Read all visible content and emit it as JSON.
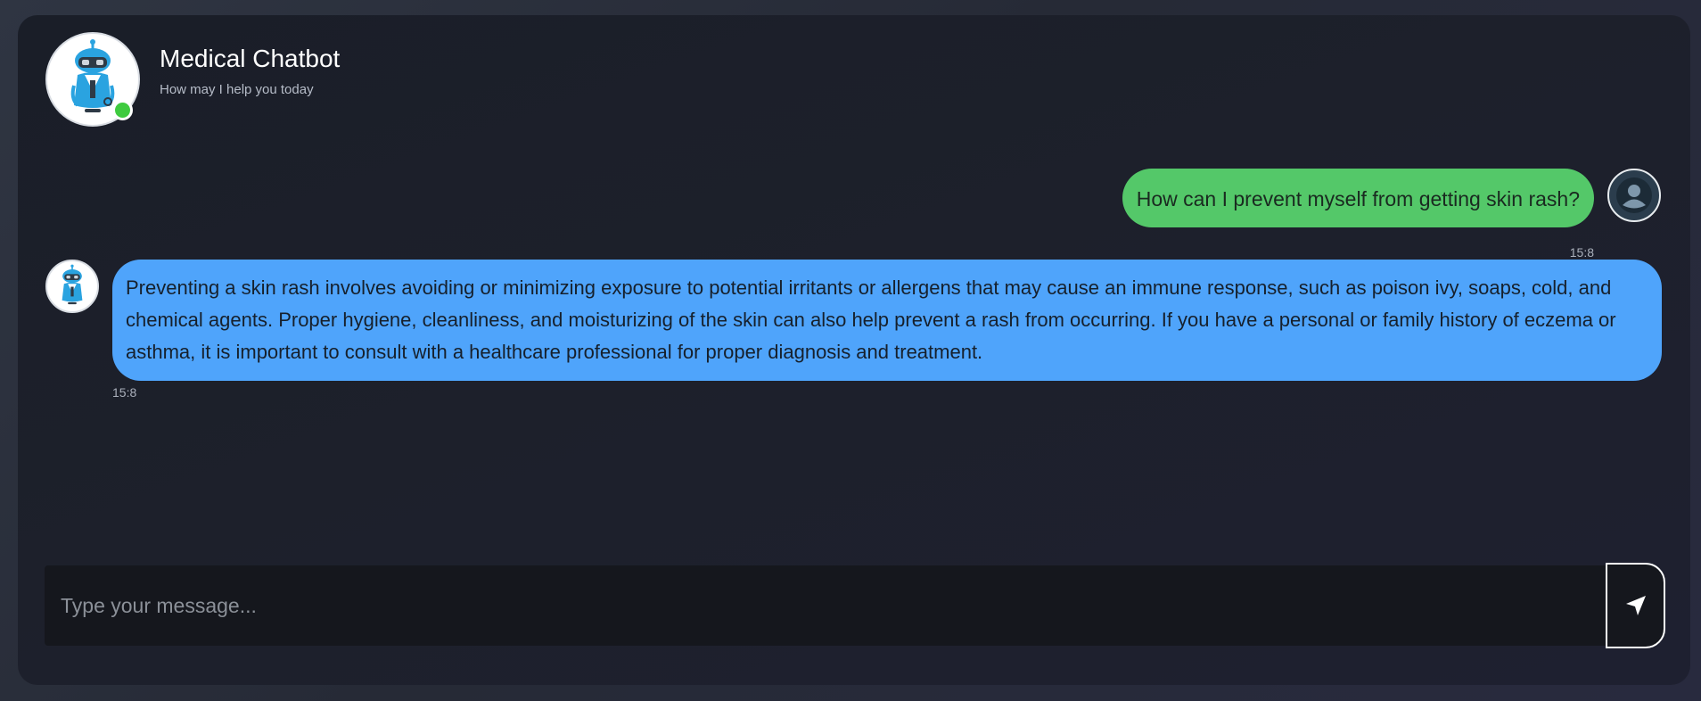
{
  "header": {
    "title": "Medical Chatbot",
    "subtitle": "How may I help you today",
    "status": "online",
    "status_color": "#3fcb3f"
  },
  "messages": [
    {
      "role": "user",
      "text": "How can I prevent myself from getting skin rash?",
      "time": "15:8",
      "bubble_color": "#54c869"
    },
    {
      "role": "bot",
      "text": "Preventing a skin rash involves avoiding or minimizing exposure to potential irritants or allergens that may cause an immune response, such as poison ivy, soaps, cold, and chemical agents. Proper hygiene, cleanliness, and moisturizing of the skin can also help prevent a rash from occurring. If you have a personal or family history of eczema or asthma, it is important to consult with a healthcare professional for proper diagnosis and treatment.",
      "time": "15:8",
      "bubble_color": "#4fa4fb"
    }
  ],
  "composer": {
    "value": "",
    "placeholder": "Type your message...",
    "send_icon": "send-arrow-icon"
  },
  "icons": {
    "bot_avatar": "robot-doctor-icon",
    "user_avatar": "user-silhouette-icon"
  }
}
